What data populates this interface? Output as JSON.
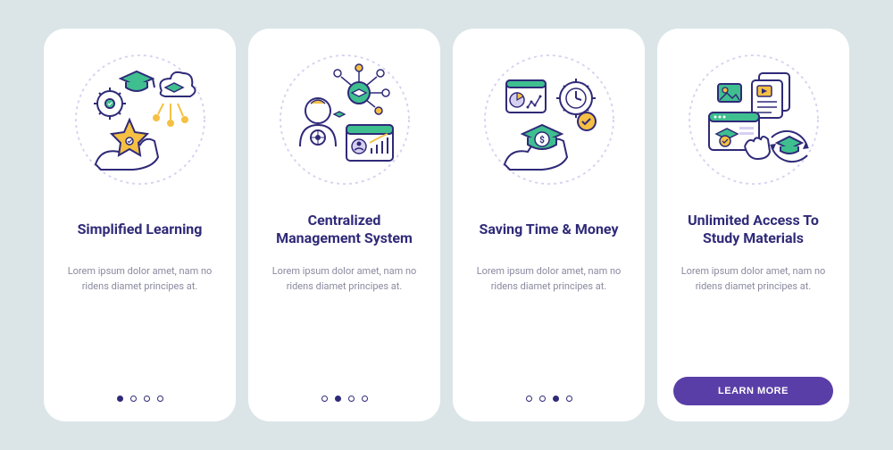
{
  "colors": {
    "background": "#dbe5e8",
    "card": "#ffffff",
    "title": "#2f2a78",
    "desc": "#8a8aa0",
    "button": "#5a3ea8",
    "accent_green": "#3fbf8f",
    "accent_yellow": "#f5c043",
    "stroke": "#2f2a78"
  },
  "cards": [
    {
      "icon": "simplified-learning",
      "title": "Simplified Learning",
      "desc": "Lorem ipsum dolor amet, nam no ridens diamet principes at.",
      "active_dot": 0
    },
    {
      "icon": "centralized-management",
      "title": "Centralized Management System",
      "desc": "Lorem ipsum dolor amet, nam no ridens diamet principes at.",
      "active_dot": 1
    },
    {
      "icon": "saving-time-money",
      "title": "Saving Time & Money",
      "desc": "Lorem ipsum dolor amet, nam no ridens diamet principes at.",
      "active_dot": 2
    },
    {
      "icon": "unlimited-access",
      "title": "Unlimited Access To Study Materials",
      "desc": "Lorem ipsum dolor amet, nam no ridens diamet principes at.",
      "active_dot": 3
    }
  ],
  "cta_label": "LEARN MORE",
  "dot_count": 4
}
